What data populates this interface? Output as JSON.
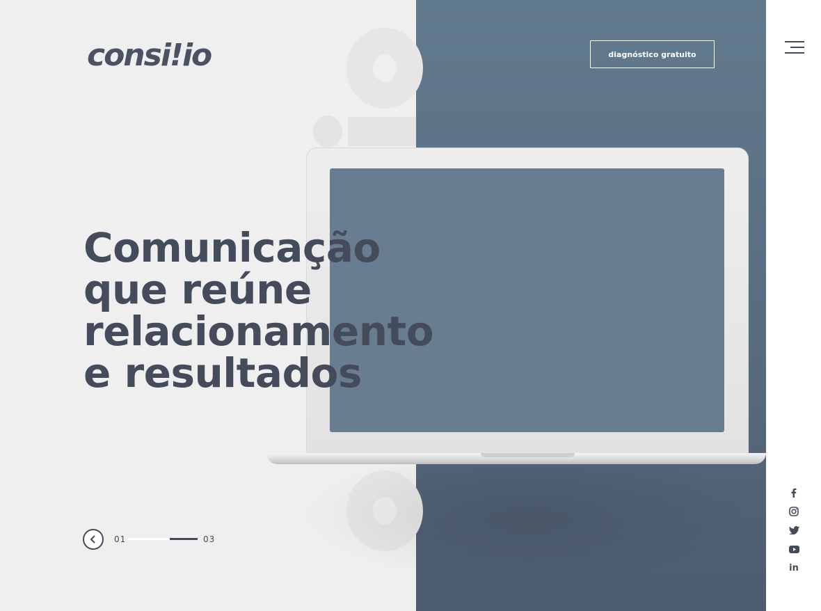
{
  "brand": {
    "logo_text": "consi!io",
    "accent": "#434a5a",
    "panel_color": "#5e7487"
  },
  "header": {
    "cta_label": "diagnóstico gratuito",
    "menu_icon": "hamburger-menu-icon"
  },
  "hero": {
    "headline_lines": [
      "Comunicação",
      "que reúne",
      "relacionamento",
      "e resultados"
    ]
  },
  "slider": {
    "current": "01",
    "total": "03",
    "progress": 0.4,
    "prev_icon": "chevron-left-icon"
  },
  "social": [
    {
      "name": "facebook",
      "glyph": "f"
    },
    {
      "name": "instagram",
      "glyph": ""
    },
    {
      "name": "twitter",
      "glyph": ""
    },
    {
      "name": "youtube",
      "glyph": ""
    },
    {
      "name": "linkedin",
      "glyph": "in"
    }
  ]
}
